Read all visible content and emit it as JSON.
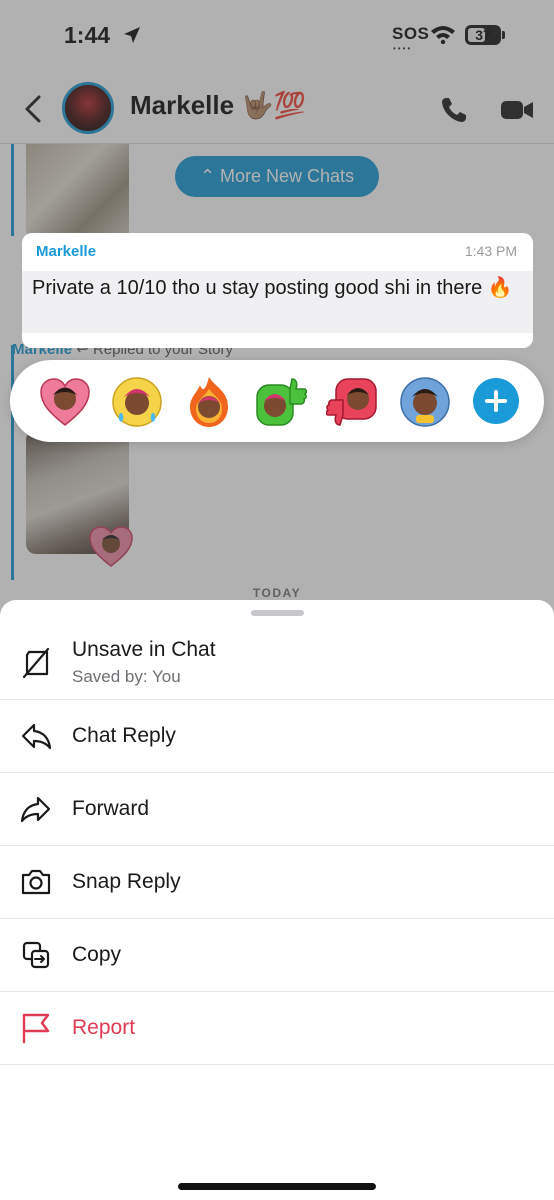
{
  "status_bar": {
    "time": "1:44",
    "sos": "SOS",
    "battery": "37"
  },
  "header": {
    "name": "Markelle",
    "name_emoji": "🤟🏽💯"
  },
  "chat": {
    "more_new_chats": "⌃ More New Chats",
    "replied_name": "Markelle",
    "replied_text": "↩ Replied to your Story",
    "today_label": "TODAY"
  },
  "message": {
    "sender": "Markelle",
    "time": "1:43 PM",
    "text": "Private a 10/10 tho u stay posting good shi in there 🔥"
  },
  "reactions": [
    {
      "name": "heart-bitmoji-reaction"
    },
    {
      "name": "laugh-cry-bitmoji-reaction"
    },
    {
      "name": "fire-bitmoji-reaction"
    },
    {
      "name": "thumbs-up-bitmoji-reaction"
    },
    {
      "name": "thumbs-down-bitmoji-reaction"
    },
    {
      "name": "crying-bitmoji-reaction"
    }
  ],
  "actions": {
    "unsave": {
      "label": "Unsave in Chat",
      "sub": "Saved by: You"
    },
    "chat_reply": {
      "label": "Chat Reply"
    },
    "forward": {
      "label": "Forward"
    },
    "snap_reply": {
      "label": "Snap Reply"
    },
    "copy": {
      "label": "Copy"
    },
    "report": {
      "label": "Report"
    }
  },
  "colors": {
    "accent": "#1a9ad6",
    "danger": "#e03b52"
  }
}
